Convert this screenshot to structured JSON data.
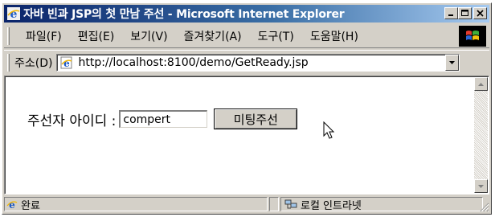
{
  "window": {
    "title": "자바 빈과 JSP의 첫 만남 주선 - Microsoft Internet Explorer"
  },
  "menu": {
    "items": [
      {
        "label": "파일(F)"
      },
      {
        "label": "편집(E)"
      },
      {
        "label": "보기(V)"
      },
      {
        "label": "즐겨찾기(A)"
      },
      {
        "label": "도구(T)"
      },
      {
        "label": "도움말(H)"
      }
    ]
  },
  "address": {
    "label": "주소(D)",
    "url": "http://localhost:8100/demo/GetReady.jsp"
  },
  "page": {
    "form_label": "주선자 아이디 :",
    "id_value": "compert",
    "submit_label": "미팅주선"
  },
  "status": {
    "left_text": "완료",
    "zone_text": "로컬 인트라넷"
  },
  "colors": {
    "title_start": "#0a246a",
    "title_end": "#a6caf0",
    "chrome": "#d4d0c8"
  }
}
